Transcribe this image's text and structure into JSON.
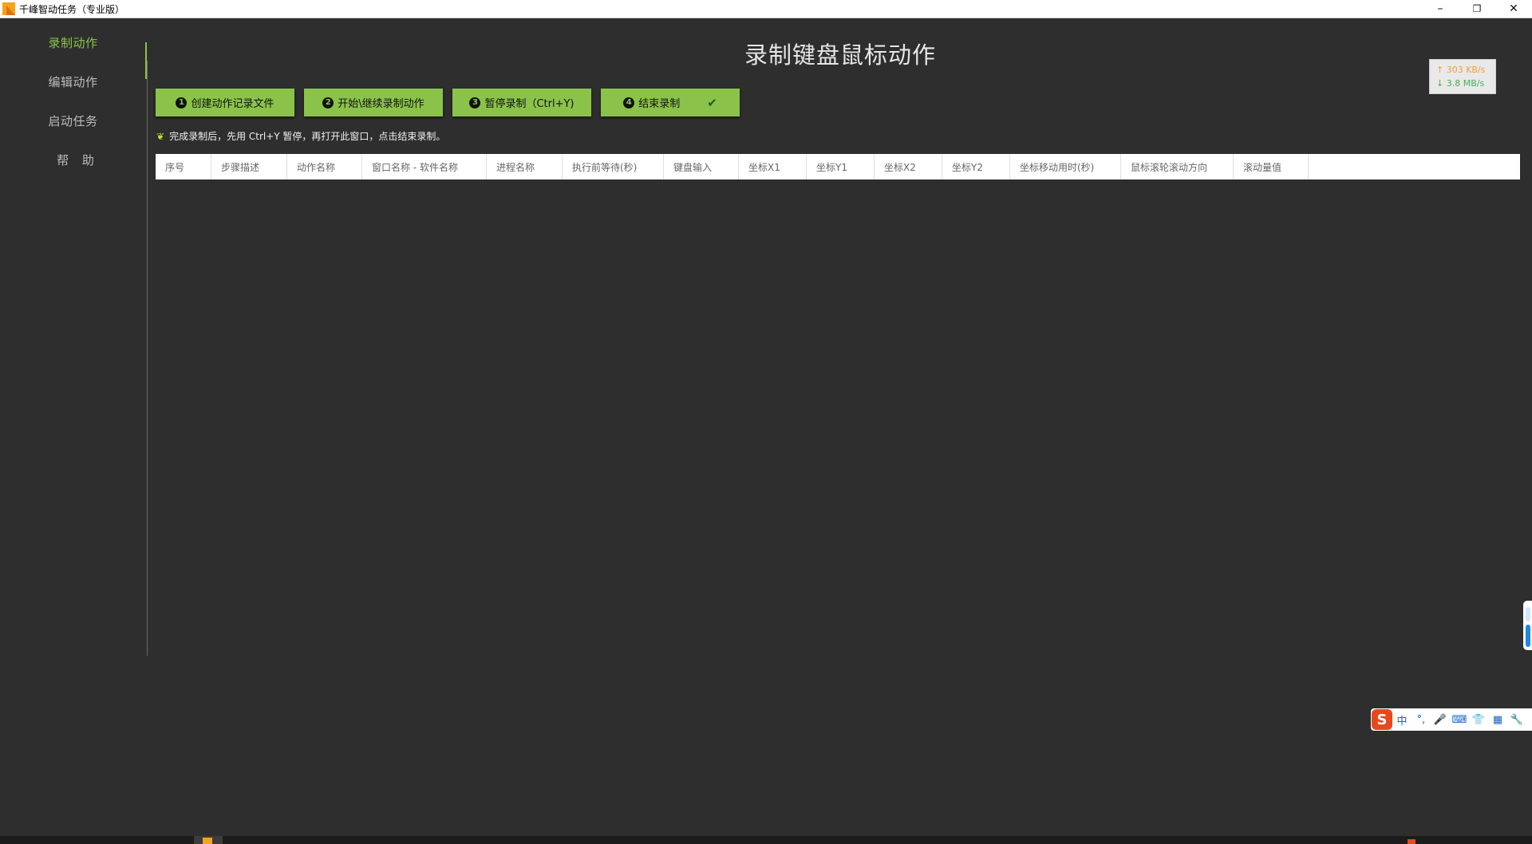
{
  "window": {
    "title": "千峰智动任务（专业版）",
    "minimize_icon": "–",
    "restore_icon": "❐",
    "close_icon": "✕"
  },
  "sidebar": {
    "items": [
      {
        "label": "录制动作",
        "active": true
      },
      {
        "label": "编辑动作",
        "active": false
      },
      {
        "label": "启动任务",
        "active": false
      },
      {
        "label": "帮 助",
        "active": false
      }
    ]
  },
  "main": {
    "title": "录制键盘鼠标动作",
    "buttons": [
      {
        "num": "1",
        "label": "创建动作记录文件"
      },
      {
        "num": "2",
        "label": "开始\\继续录制动作"
      },
      {
        "num": "3",
        "label": "暂停录制（Ctrl+Y)"
      },
      {
        "num": "4",
        "label": "结束录制",
        "check": "✔"
      }
    ],
    "hint": "完成录制后，先用 Ctrl+Y 暂停，再打开此窗口，点击结束录制。",
    "table_columns": [
      "序号",
      "步骤描述",
      "动作名称",
      "窗口名称 - 软件名称",
      "进程名称",
      "执行前等待(秒)",
      "键盘输入",
      "坐标X1",
      "坐标Y1",
      "坐标X2",
      "坐标Y2",
      "坐标移动用时(秒)",
      "鼠标滚轮滚动方向",
      "滚动量值"
    ]
  },
  "speed": {
    "upload": "↑ 303 KB/s",
    "download": "↓ 3.8 MB/s"
  },
  "ime": {
    "logo": "S",
    "items": [
      "中",
      "°,",
      "🎤",
      "⌨",
      "👕",
      "▦",
      "🔧"
    ]
  },
  "colors": {
    "accent": "#8bc34a",
    "background": "#2e2e2e"
  }
}
